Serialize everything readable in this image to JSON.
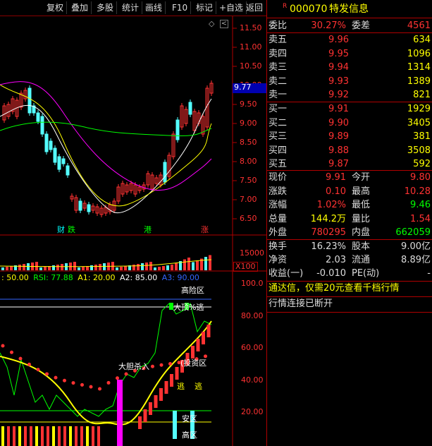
{
  "toolbar": {
    "items": [
      {
        "label": "复权"
      },
      {
        "label": "叠加"
      },
      {
        "label": "多股"
      },
      {
        "label": "统计"
      },
      {
        "label": "画线"
      },
      {
        "label": "F10"
      },
      {
        "label": "标记"
      },
      {
        "label": "+自选"
      },
      {
        "label": "返回"
      }
    ]
  },
  "chart": {
    "price_axis": [
      "11.50",
      "11.00",
      "10.50",
      "10.00",
      "9.50",
      "9.00",
      "8.50",
      "8.00",
      "7.50",
      "7.00",
      "6.50"
    ],
    "current_price_tag": "9.77",
    "event_tags": [
      {
        "label": "财"
      },
      {
        "label": "跌"
      },
      {
        "label": "港"
      },
      {
        "label": "涨"
      }
    ],
    "volume_axis": "15000",
    "volume_unit": "X100",
    "indicator_header": {
      "v1": ": 50.00",
      "rsi": "RSI: 77.88",
      "a1": "A1: 20.00",
      "a2": "A2: 85.00",
      "a3": "A3: 90.00"
    },
    "indicator_axis": [
      "100.0",
      "80.00",
      "60.00",
      "40.00",
      "20.00"
    ],
    "annotations": {
      "high_risk": "高险区",
      "top_escape": "大顶%逃",
      "big_kill": "大胆杀入",
      "invest": "(投资区",
      "escape1": "逃",
      "escape2": "逃",
      "safe": "安区",
      "low_zone": "高区"
    },
    "colors": {
      "up": "#ff3232",
      "down": "#54ffff",
      "ma1": "#ffffff",
      "ma2": "#ffff00",
      "ma3": "#ff00ff",
      "ma4": "#00ff00",
      "grid": "#b00000"
    }
  },
  "quote": {
    "code": "000070",
    "name": "特发信息",
    "badge": "R",
    "weibi_label": "委比",
    "weibi": "30.27%",
    "weicha_label": "委差",
    "weicha": "4561",
    "sell": [
      {
        "label": "卖五",
        "price": "9.96",
        "vol": "634"
      },
      {
        "label": "卖四",
        "price": "9.95",
        "vol": "1096"
      },
      {
        "label": "卖三",
        "price": "9.94",
        "vol": "1314"
      },
      {
        "label": "卖二",
        "price": "9.93",
        "vol": "1389"
      },
      {
        "label": "卖一",
        "price": "9.92",
        "vol": "821"
      }
    ],
    "buy": [
      {
        "label": "买一",
        "price": "9.91",
        "vol": "1929"
      },
      {
        "label": "买二",
        "price": "9.90",
        "vol": "3405"
      },
      {
        "label": "买三",
        "price": "9.89",
        "vol": "381"
      },
      {
        "label": "买四",
        "price": "9.88",
        "vol": "3508"
      },
      {
        "label": "买五",
        "price": "9.87",
        "vol": "592"
      }
    ],
    "stats": [
      {
        "l1": "现价",
        "v1": "9.91",
        "l2": "今开",
        "v2": "9.80"
      },
      {
        "l1": "涨跌",
        "v1": "0.10",
        "l2": "最高",
        "v2": "10.28"
      },
      {
        "l1": "涨幅",
        "v1": "1.02%",
        "l2": "最低",
        "v2": "9.46"
      },
      {
        "l1": "总量",
        "v1": "144.2万",
        "l2": "量比",
        "v2": "1.54"
      },
      {
        "l1": "外盘",
        "v1": "780295",
        "l2": "内盘",
        "v2": "662059"
      }
    ],
    "fin": [
      {
        "l1": "换手",
        "v1": "16.23%",
        "l2": "股本",
        "v2": "9.00亿"
      },
      {
        "l1": "净资",
        "v1": "2.03",
        "l2": "流通",
        "v2": "8.89亿"
      },
      {
        "l1": "收益(一)",
        "v1": "-0.010",
        "l2": "PE(动)",
        "v2": "-"
      }
    ],
    "ad_text": "通达信，仅需20元查看千档行情",
    "status_text": "行情连接已断开"
  }
}
